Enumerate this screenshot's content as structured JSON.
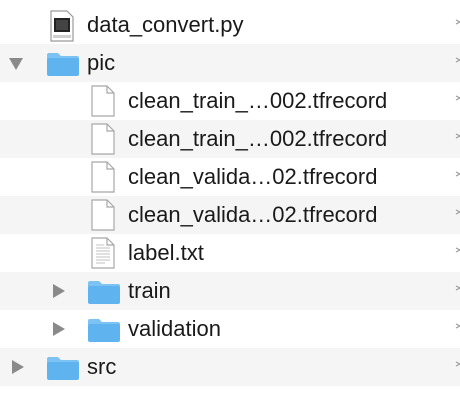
{
  "file_tree": {
    "items": [
      {
        "name": "data_convert.py",
        "kind": "python-file",
        "icon": "python-file-icon",
        "indent": 0,
        "expander": "none"
      },
      {
        "name": "pic",
        "kind": "folder",
        "icon": "folder-icon",
        "indent": 0,
        "expander": "expanded"
      },
      {
        "name": "clean_train_…002.tfrecord",
        "kind": "file",
        "icon": "document-icon",
        "indent": 1,
        "expander": "none"
      },
      {
        "name": "clean_train_…002.tfrecord",
        "kind": "file",
        "icon": "document-icon",
        "indent": 1,
        "expander": "none"
      },
      {
        "name": "clean_valida…02.tfrecord",
        "kind": "file",
        "icon": "document-icon",
        "indent": 1,
        "expander": "none"
      },
      {
        "name": "clean_valida…02.tfrecord",
        "kind": "file",
        "icon": "document-icon",
        "indent": 1,
        "expander": "none"
      },
      {
        "name": "label.txt",
        "kind": "text-file",
        "icon": "text-document-icon",
        "indent": 1,
        "expander": "none"
      },
      {
        "name": "train",
        "kind": "folder",
        "icon": "folder-icon",
        "indent": 1,
        "expander": "collapsed"
      },
      {
        "name": "validation",
        "kind": "folder",
        "icon": "folder-icon",
        "indent": 1,
        "expander": "collapsed"
      },
      {
        "name": "src",
        "kind": "folder",
        "icon": "folder-icon",
        "indent": 0,
        "expander": "collapsed"
      }
    ]
  },
  "colors": {
    "folder": "#5fb3ee",
    "folder_tab": "#7cc3f3",
    "alt_row": "#f5f5f5",
    "text": "#1a1a1a",
    "disclosure": "#8a8a8a"
  }
}
